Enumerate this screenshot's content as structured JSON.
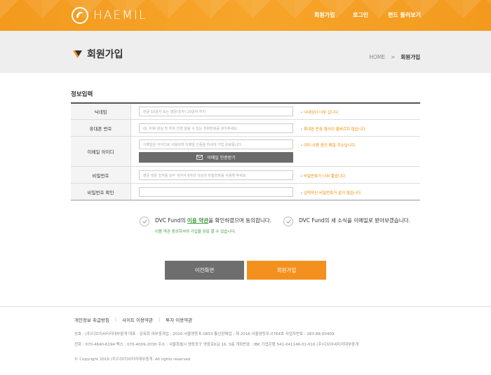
{
  "header": {
    "logo_text": "HAEMIL",
    "nav": [
      "회원가입",
      "로그인",
      "펀드 둘러보기"
    ]
  },
  "title_band": {
    "title": "회원가입",
    "breadcrumb": [
      "HOME",
      ">",
      "회원가입"
    ]
  },
  "form": {
    "section_title": "정보입력",
    "rows": [
      {
        "label": "닉네임",
        "placeholder": "한글 10글자 또는 영문(숫자) 20글자 까지",
        "hint": "• 닉네임이 너무 깁니다."
      },
      {
        "label": "휴대폰 번호",
        "placeholder": "ID, P/W 분실 및 투자 진행 알림 수 있는 전화번호를 넣어주세요.",
        "hint": "• 휴대폰 번호 형식이 올바르지 않습니다."
      },
      {
        "label": "이메일 아이디",
        "placeholder": "이메일은 아이디로 사용되며 이메일 인증을 하셔야 가입 완료됩니다.",
        "hint": "• 이미 사용 중인 메일 주소입니다.",
        "button": "이메일 인증받기"
      },
      {
        "label": "비밀번호",
        "placeholder": "영문 대문 숫자를 모두 섞어서 8자리 이상의 비밀번호를 사용해 주세요.",
        "hint": "• 비밀번호가 너무 짧습니다."
      },
      {
        "label": "비밀번호 확인",
        "placeholder": "",
        "hint": "• 입력하신 비밀번호가 같지 않습니다."
      }
    ]
  },
  "agreements": {
    "terms_prefix": "DVC Fund의 ",
    "terms_link": "이용 약관",
    "terms_suffix": "을 확인하였으며 동의합니다.",
    "terms_sub": "이용 약관 동의하셔야 가입을 완료 할 수 있습니다.",
    "newsletter": "DVC Fund의 새 소식을 이메일로 받아보겠습니다."
  },
  "buttons": {
    "prev": "이전화면",
    "join": "회원가입"
  },
  "footer": {
    "links": [
      "개인정보 취급방침",
      "사이트 이용약관",
      "투자 이용약관"
    ],
    "info_line1": "상호 : (주)디브이씨티리대부중개     대표 : 김옥희     대부중개업 : 2016-서울영등포-0853     통신판매업 : 제 2016-서울영등포-0764호     사업자번호 : 283-88-00409",
    "info_line2": "전화 : 070-4640-6194    팩스 : 070-4009-2030     주소 : 서울특별시 영등포구 영중로6길 16, 3층     개좌번호 : IBK 기업은행 541-041146-01-010 (주)디브이씨티리대부중개",
    "copyright": "© Copyright 2016 (주)디브이씨티리대부중개. All rights reserved"
  },
  "colors": {
    "accent": "#f4901e",
    "link_green": "#3e9b3a",
    "hint_orange": "#f08a00"
  }
}
